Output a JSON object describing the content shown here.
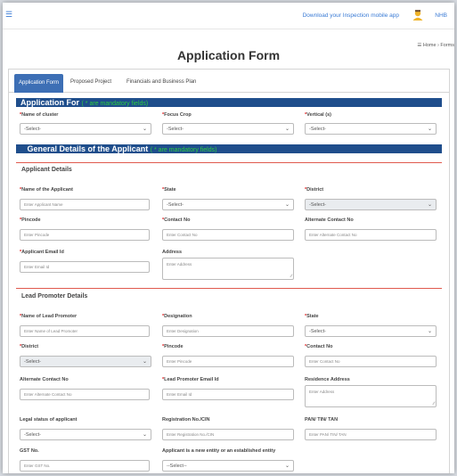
{
  "topbar": {
    "menu_icon": "hamburger-icon",
    "download_link": "Download your Inspection mobile app",
    "user_name": "NHB"
  },
  "breadcrumb": "☰ Home › Forms",
  "page_title": "Application Form",
  "tabs": [
    {
      "label": "Application Form",
      "active": true
    },
    {
      "label": "Proposed Project",
      "active": false
    },
    {
      "label": "Financials and Business Plan",
      "active": false
    }
  ],
  "section_application": {
    "title": "Application For",
    "note": "( * are mandatory fields)"
  },
  "application_for": {
    "cluster": {
      "label": "Name of cluster",
      "value": "-Select-"
    },
    "focus_crop": {
      "label": "Focus Crop",
      "value": "-Select-"
    },
    "vertical": {
      "label": "Vertical (s)",
      "value": "-Select-"
    }
  },
  "section_general": {
    "title": "General Details of the Applicant",
    "note": "( * are mandatory fields)"
  },
  "applicant_details": {
    "title": "Applicant Details",
    "name": {
      "label": "Name of the Applicant",
      "placeholder": "Enter Applicant Name"
    },
    "state": {
      "label": "State",
      "value": "-Select-"
    },
    "district": {
      "label": "District",
      "value": "-Select-"
    },
    "pincode": {
      "label": "Pincode",
      "placeholder": "Enter Pincode"
    },
    "contact": {
      "label": "Contact No",
      "placeholder": "Enter Contact No"
    },
    "alt_contact": {
      "label": "Alternate Contact No",
      "placeholder": "Enter Alternate Contact No"
    },
    "email": {
      "label": "Applicant Email Id",
      "placeholder": "Enter Email Id"
    },
    "address": {
      "label": "Address",
      "placeholder": "Enter Address"
    }
  },
  "lead_promoter": {
    "title": "Lead Promoter Details",
    "name": {
      "label": "Name of Lead Promoter",
      "placeholder": "Enter Name of Lead Promoter"
    },
    "designation": {
      "label": "Designation",
      "placeholder": "Enter Designation"
    },
    "state": {
      "label": "State",
      "value": "-Select-"
    },
    "district": {
      "label": "District",
      "value": "-Select-"
    },
    "pincode": {
      "label": "Pincode",
      "placeholder": "Enter Pincode"
    },
    "contact": {
      "label": "Contact No",
      "placeholder": "Enter Contact No"
    },
    "alt_contact": {
      "label": "Alternate Contact No",
      "placeholder": "Enter Alternate Contact No"
    },
    "email": {
      "label": "Lead Promoter Email Id",
      "placeholder": "Enter Email Id"
    },
    "residence": {
      "label": "Residence Address",
      "placeholder": "Enter Address"
    },
    "legal_status": {
      "label": "Legal status of applicant",
      "value": "-Select-"
    },
    "registration": {
      "label": "Registration No./CIN",
      "placeholder": "Enter Registration No./CIN"
    },
    "pan": {
      "label": "PAN/ TIN/ TAN",
      "placeholder": "Enter PAN/ TIN/ TAN"
    },
    "gst": {
      "label": "GST No.",
      "placeholder": "Enter GST No."
    },
    "entity": {
      "label": "Applicant is a new entity or an established entity",
      "value": "--Select--"
    }
  },
  "colors": {
    "tab_active": "#3d6fb5",
    "section_bar": "#1f4e8c",
    "note_green": "#2ecc40",
    "required_red": "#e02020",
    "divider_red": "#e05a4e"
  }
}
